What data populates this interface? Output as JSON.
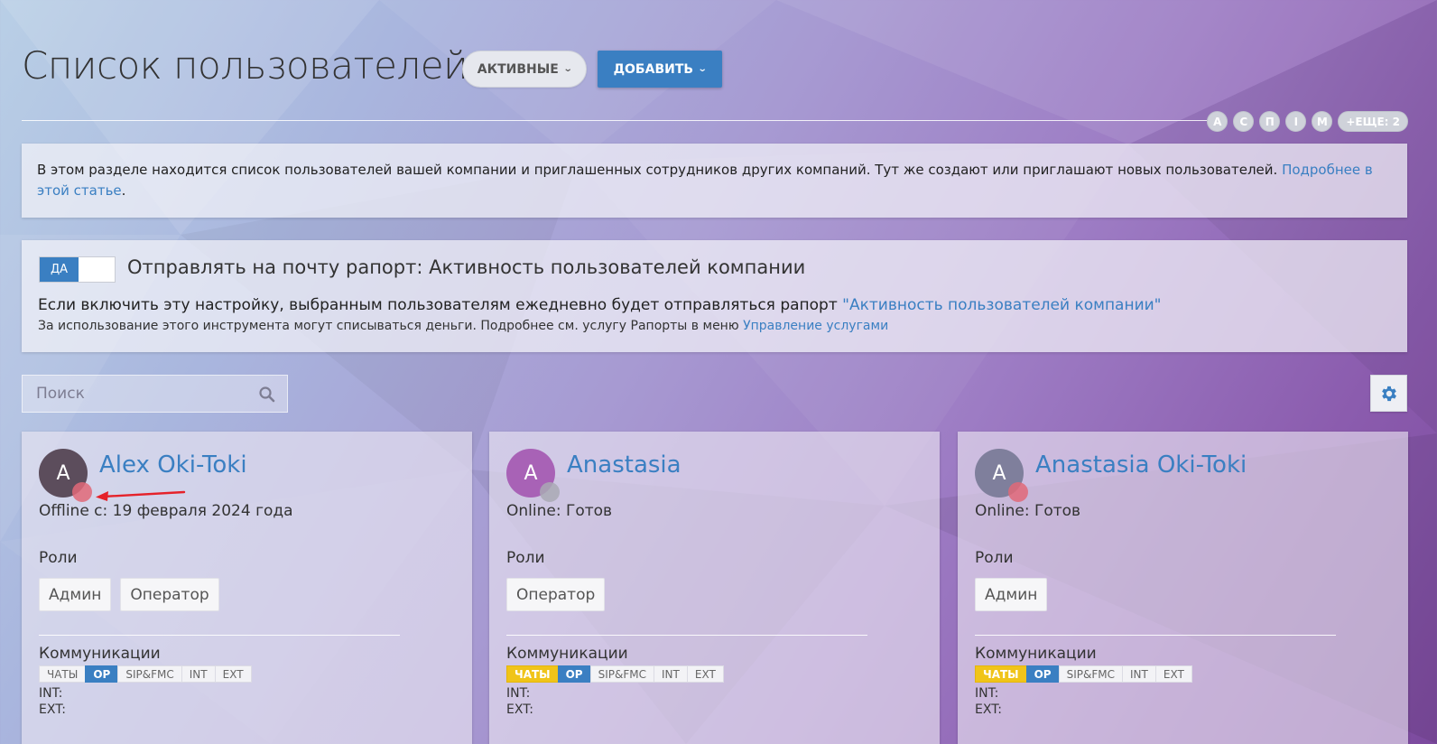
{
  "header": {
    "title": "Список пользователей",
    "filter_label": "АКТИВНЫЕ",
    "add_label": "ДОБАВИТЬ"
  },
  "letters": [
    "А",
    "С",
    "П",
    "I",
    "М"
  ],
  "more_label": "+ЕЩЕ: 2",
  "info": {
    "text": "В этом разделе находится список пользователей вашей компании и приглашенных сотрудников других компаний. Тут же создают или приглашают новых пользователей.",
    "link": "Подробнее в этой статье",
    "period": "."
  },
  "report": {
    "toggle_label": "ДА",
    "title": "Отправлять на почту рапорт: Активность пользователей компании",
    "desc": "Если включить эту настройку, выбранным пользователям ежедневно будет отправляться рапорт",
    "desc_link": "\"Активность пользователей компании\"",
    "note": "За использование этого инструмента могут списываться деньги. Подробнее см. услугу Рапорты в меню",
    "note_link": "Управление услугами"
  },
  "search": {
    "placeholder": "Поиск"
  },
  "cards": [
    {
      "initial": "A",
      "name": "Alex Oki-Toki",
      "status": "Offline с: 19 февраля 2024 года",
      "roles_label": "Роли",
      "roles": [
        "Админ",
        "Оператор"
      ],
      "comm_label": "Коммуникации",
      "tags": [
        "ЧАТЫ",
        "OP",
        "SIP&FMC",
        "INT",
        "EXT"
      ],
      "int_label": "INT:",
      "ext_label": "EXT:",
      "avatar_color": "#5c4d5c",
      "dot_color": "#e06878"
    },
    {
      "initial": "A",
      "name": "Anastasia",
      "status": "Online: Готов",
      "roles_label": "Роли",
      "roles": [
        "Оператор"
      ],
      "comm_label": "Коммуникации",
      "tags": [
        "ЧАТЫ",
        "OP",
        "SIP&FMC",
        "INT",
        "EXT"
      ],
      "int_label": "INT:",
      "ext_label": "EXT:",
      "avatar_color": "#a862b6",
      "dot_color": "#a9a9b4"
    },
    {
      "initial": "A",
      "name": "Anastasia Oki-Toki",
      "status": "Online: Готов",
      "roles_label": "Роли",
      "roles": [
        "Админ"
      ],
      "comm_label": "Коммуникации",
      "tags": [
        "ЧАТЫ",
        "OP",
        "SIP&FMC",
        "INT",
        "EXT"
      ],
      "int_label": "INT:",
      "ext_label": "EXT:",
      "avatar_color": "#7f7f9c",
      "dot_color": "#e06878"
    }
  ],
  "colors": {
    "accent": "#3a7fc2",
    "chat_active": "#f0c419",
    "arrow": "#e5222a"
  }
}
